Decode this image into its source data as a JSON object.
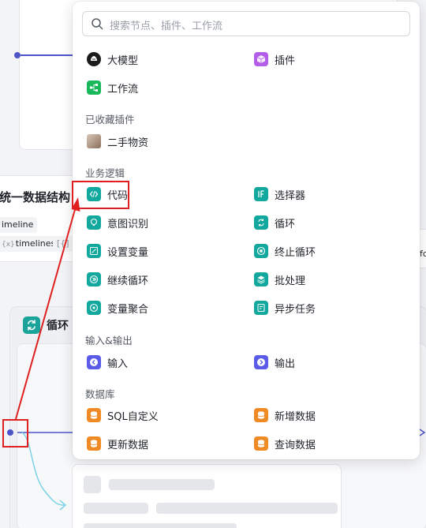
{
  "search": {
    "placeholder": "搜索节点、插件、工作流"
  },
  "top_items": [
    {
      "label": "大模型",
      "icon": "llm-icon"
    },
    {
      "label": "插件",
      "icon": "plugin-icon"
    },
    {
      "label": "工作流",
      "icon": "workflow-icon"
    }
  ],
  "favorites": {
    "title": "已收藏插件",
    "items": [
      {
        "label": "二手物资",
        "icon": "avatar-thumbnail"
      }
    ]
  },
  "logic": {
    "title": "业务逻辑",
    "items": [
      {
        "label": "代码",
        "icon": "code-icon"
      },
      {
        "label": "选择器",
        "icon": "if-icon"
      },
      {
        "label": "意图识别",
        "icon": "intent-icon"
      },
      {
        "label": "循环",
        "icon": "loop-icon"
      },
      {
        "label": "设置变量",
        "icon": "set-variable-icon"
      },
      {
        "label": "终止循环",
        "icon": "stop-loop-icon"
      },
      {
        "label": "继续循环",
        "icon": "continue-loop-icon"
      },
      {
        "label": "批处理",
        "icon": "batch-icon"
      },
      {
        "label": "变量聚合",
        "icon": "variable-aggregate-icon"
      },
      {
        "label": "异步任务",
        "icon": "async-task-icon"
      }
    ]
  },
  "io": {
    "title": "输入&输出",
    "items": [
      {
        "label": "输入",
        "icon": "input-icon"
      },
      {
        "label": "输出",
        "icon": "output-icon"
      }
    ]
  },
  "database": {
    "title": "数据库",
    "items": [
      {
        "label": "SQL自定义",
        "icon": "database-icon"
      },
      {
        "label": "新增数据",
        "icon": "database-add-icon"
      },
      {
        "label": "更新数据",
        "icon": "database-update-icon"
      },
      {
        "label": "查询数据",
        "icon": "database-query-icon"
      }
    ]
  },
  "canvas": {
    "node_title": "统一数据结构",
    "tags": [
      "imeline",
      "timelines",
      "[{]"
    ],
    "right_tag": "fo",
    "loop_title": "循环"
  },
  "colors": {
    "teal": "#13a89e",
    "blue": "#5a5ce8",
    "orange": "#f08a24",
    "purple": "#b25ee8",
    "green": "#19b85a",
    "highlight": "#e02020"
  }
}
